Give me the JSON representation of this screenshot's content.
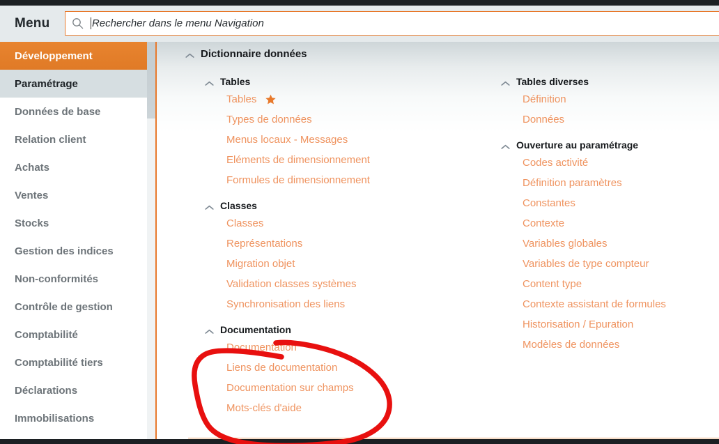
{
  "header": {
    "menu_label": "Menu",
    "search": {
      "placeholder": "Rechercher dans le menu Navigation",
      "value": "",
      "icon": "search-icon"
    }
  },
  "sidebar": {
    "items": [
      {
        "label": "Développement",
        "state": "active-orange"
      },
      {
        "label": "Paramétrage",
        "state": "active-grey"
      },
      {
        "label": "Données de base",
        "state": "normal"
      },
      {
        "label": "Relation client",
        "state": "normal"
      },
      {
        "label": "Achats",
        "state": "normal"
      },
      {
        "label": "Ventes",
        "state": "normal"
      },
      {
        "label": "Stocks",
        "state": "normal"
      },
      {
        "label": "Gestion des indices",
        "state": "normal"
      },
      {
        "label": "Non-conformités",
        "state": "normal"
      },
      {
        "label": "Contrôle de gestion",
        "state": "normal"
      },
      {
        "label": "Comptabilité",
        "state": "normal"
      },
      {
        "label": "Comptabilité tiers",
        "state": "normal"
      },
      {
        "label": "Déclarations",
        "state": "normal"
      },
      {
        "label": "Immobilisations",
        "state": "normal"
      }
    ]
  },
  "content": {
    "root_group": {
      "label": "Dictionnaire données",
      "icon": "chevron-up-icon"
    },
    "left_column": [
      {
        "label": "Tables",
        "icon": "chevron-up-icon",
        "items": [
          {
            "label": "Tables",
            "favorite": true
          },
          {
            "label": "Types de données",
            "favorite": false
          },
          {
            "label": "Menus locaux - Messages",
            "favorite": false
          },
          {
            "label": "Eléments de dimensionnement",
            "favorite": false
          },
          {
            "label": "Formules de dimensionnement",
            "favorite": false
          }
        ]
      },
      {
        "label": "Classes",
        "icon": "chevron-up-icon",
        "items": [
          {
            "label": "Classes",
            "favorite": false
          },
          {
            "label": "Représentations",
            "favorite": false
          },
          {
            "label": "Migration objet",
            "favorite": false
          },
          {
            "label": "Validation classes systèmes",
            "favorite": false
          },
          {
            "label": "Synchronisation des liens",
            "favorite": false
          }
        ]
      },
      {
        "label": "Documentation",
        "icon": "chevron-up-icon",
        "items": [
          {
            "label": "Documentation",
            "favorite": false
          },
          {
            "label": "Liens de documentation",
            "favorite": false
          },
          {
            "label": "Documentation sur champs",
            "favorite": false
          },
          {
            "label": "Mots-clés d'aide",
            "favorite": false
          }
        ]
      }
    ],
    "right_column": [
      {
        "label": "Tables diverses",
        "icon": "chevron-up-icon",
        "items": [
          {
            "label": "Définition",
            "favorite": false
          },
          {
            "label": "Données",
            "favorite": false
          }
        ]
      },
      {
        "label": "Ouverture au paramétrage",
        "icon": "chevron-up-icon",
        "items": [
          {
            "label": "Codes activité",
            "favorite": false
          },
          {
            "label": "Définition paramètres",
            "favorite": false
          },
          {
            "label": "Constantes",
            "favorite": false
          },
          {
            "label": "Contexte",
            "favorite": false
          },
          {
            "label": "Variables globales",
            "favorite": false
          },
          {
            "label": "Variables de type compteur",
            "favorite": false
          },
          {
            "label": "Content type",
            "favorite": false
          },
          {
            "label": "Contexte assistant de formules",
            "favorite": false
          },
          {
            "label": "Historisation / Epuration",
            "favorite": false
          },
          {
            "label": "Modèles de données",
            "favorite": false
          }
        ]
      }
    ]
  },
  "annotation": {
    "type": "hand-drawn-ellipse",
    "color": "#e8100f",
    "encircles": [
      "Documentation",
      "Liens de documentation",
      "Documentation sur champs",
      "Mots-clés d'aide"
    ]
  },
  "colors": {
    "accent_orange": "#e8792b",
    "link_orange": "#ef935f",
    "header_background": "#e5eaec",
    "sidebar_active_grey": "#d6dee1",
    "dark_strip": "#1c2023",
    "annotation_red": "#e8100f"
  }
}
